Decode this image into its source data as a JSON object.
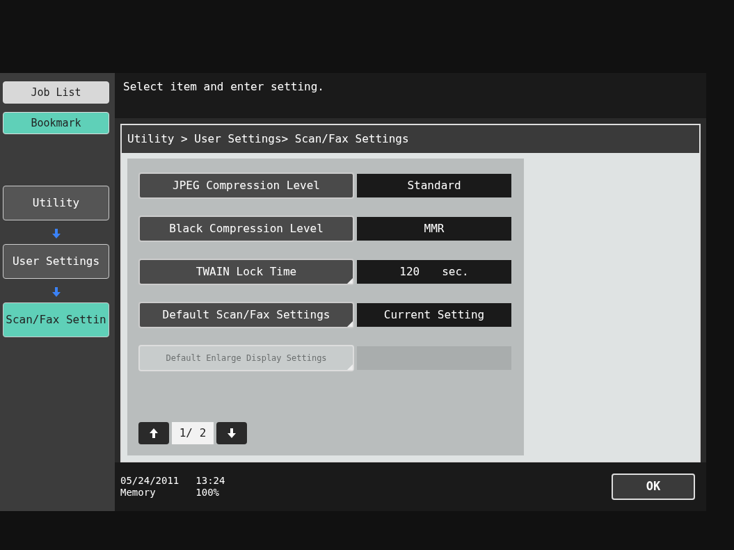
{
  "sidebar": {
    "buttons": [
      {
        "label": "Job List",
        "selected": false
      },
      {
        "label": "Bookmark",
        "selected": true
      }
    ],
    "path": [
      {
        "label": "Utility",
        "selected": false
      },
      {
        "label": "User Settings",
        "selected": false
      },
      {
        "label": "Scan/Fax Settin",
        "selected": true
      }
    ]
  },
  "message": "Select item and enter setting.",
  "breadcrumb": "Utility > User Settings> Scan/Fax Settings",
  "settings": [
    {
      "label": "JPEG Compression Level",
      "value": "Standard",
      "submenu": false,
      "disabled": false
    },
    {
      "label": "Black Compression Level",
      "value": "MMR",
      "submenu": false,
      "disabled": false
    },
    {
      "label": "TWAIN Lock Time",
      "value": "120",
      "unit": "sec.",
      "submenu": true,
      "disabled": false
    },
    {
      "label": "Default Scan/Fax Settings",
      "value": "Current Setting",
      "submenu": true,
      "disabled": false
    },
    {
      "label": "Default Enlarge Display Settings",
      "submenu": true,
      "disabled": true
    }
  ],
  "pager": {
    "page": "1/ 2"
  },
  "status": {
    "date": "05/24/2011",
    "time": "13:24",
    "memory_label": "Memory",
    "memory": "100%"
  },
  "ok_button": "OK"
}
